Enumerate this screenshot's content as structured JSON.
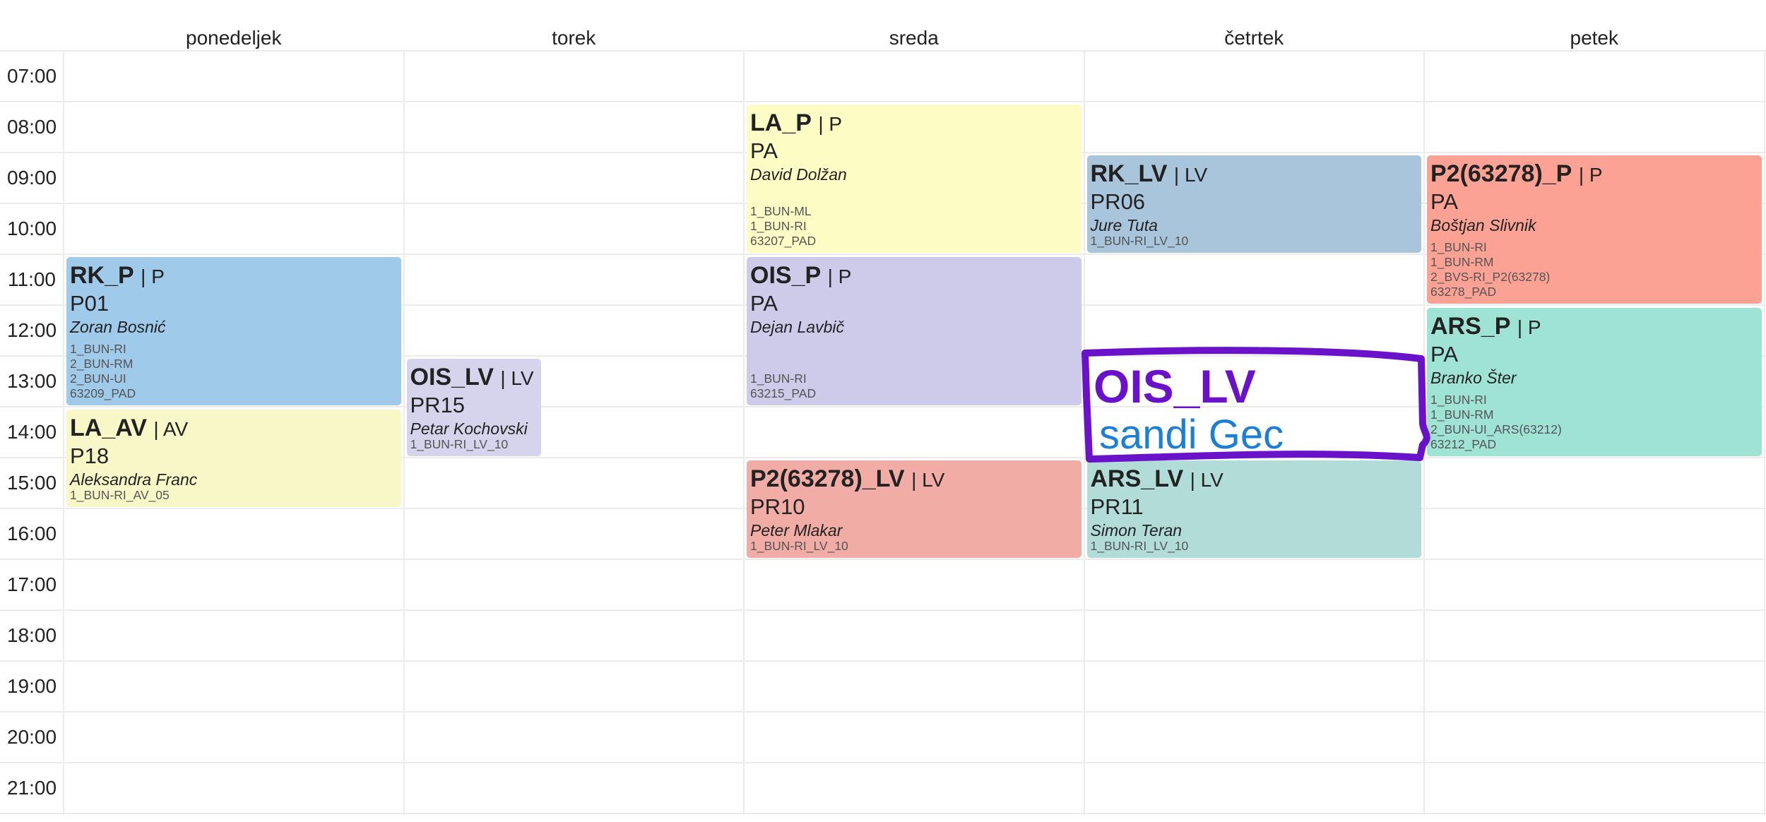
{
  "days": [
    "ponedeljek",
    "torek",
    "sreda",
    "četrtek",
    "petek"
  ],
  "times": [
    "07:00",
    "08:00",
    "09:00",
    "10:00",
    "11:00",
    "12:00",
    "13:00",
    "14:00",
    "15:00",
    "16:00",
    "17:00",
    "18:00",
    "19:00",
    "20:00",
    "21:00"
  ],
  "blocks": [
    {
      "id": "rk-p",
      "day": 0,
      "start": 11,
      "hours": 3,
      "code": "RK_P",
      "type": "| P",
      "room": "P01",
      "teacher": "Zoran Bosnić",
      "groups": [
        "1_BUN-RI",
        "2_BUN-RM",
        "2_BUN-UI",
        "63209_PAD"
      ],
      "color": "c-blue"
    },
    {
      "id": "la-av",
      "day": 0,
      "start": 14,
      "hours": 2,
      "code": "LA_AV",
      "type": "| AV",
      "room": "P18",
      "teacher": "Aleksandra Franc",
      "groups": [
        "1_BUN-RI_AV_05"
      ],
      "color": "c-ltyellow"
    },
    {
      "id": "ois-lv",
      "day": 1,
      "start": 13,
      "hours": 2,
      "code": "OIS_LV",
      "type": "| LV",
      "room": "PR15",
      "teacher": "Petar Kochovski",
      "groups": [
        "1_BUN-RI_LV_10"
      ],
      "color": "c-lavender2",
      "width": "narrow"
    },
    {
      "id": "la-p",
      "day": 2,
      "start": 8,
      "hours": 3,
      "code": "LA_P",
      "type": "| P",
      "room": "PA",
      "teacher": "David Dolžan",
      "groups": [
        "1_BUN-ML",
        "1_BUN-RI",
        "63207_PAD"
      ],
      "color": "c-yellow"
    },
    {
      "id": "ois-p",
      "day": 2,
      "start": 11,
      "hours": 3,
      "code": "OIS_P",
      "type": "| P",
      "room": "PA",
      "teacher": "Dejan Lavbič",
      "groups": [
        "1_BUN-RI",
        "63215_PAD"
      ],
      "color": "c-lavender"
    },
    {
      "id": "p2-lv",
      "day": 2,
      "start": 15,
      "hours": 2,
      "code": "P2(63278)_LV",
      "type": "| LV",
      "room": "PR10",
      "teacher": "Peter Mlakar",
      "groups": [
        "1_BUN-RI_LV_10"
      ],
      "color": "c-red"
    },
    {
      "id": "rk-lv",
      "day": 3,
      "start": 9,
      "hours": 2,
      "code": "RK_LV",
      "type": "| LV",
      "room": "PR06",
      "teacher": "Jure Tuta",
      "groups": [
        "1_BUN-RI_LV_10"
      ],
      "color": "c-steel"
    },
    {
      "id": "ars-lv",
      "day": 3,
      "start": 15,
      "hours": 2,
      "code": "ARS_LV",
      "type": "| LV",
      "room": "PR11",
      "teacher": "Simon Teran",
      "groups": [
        "1_BUN-RI_LV_10"
      ],
      "color": "c-mint"
    },
    {
      "id": "p2-p",
      "day": 4,
      "start": 9,
      "hours": 3,
      "code": "P2(63278)_P",
      "type": "| P",
      "room": "PA",
      "teacher": "Boštjan Slivnik",
      "groups": [
        "1_BUN-RI",
        "1_BUN-RM",
        "2_BVS-RI_P2(63278)",
        "63278_PAD"
      ],
      "color": "c-salmon"
    },
    {
      "id": "ars-p",
      "day": 4,
      "start": 12,
      "hours": 3,
      "code": "ARS_P",
      "type": "| P",
      "room": "PA",
      "teacher": "Branko Šter",
      "groups": [
        "1_BUN-RI",
        "1_BUN-RM",
        "2_BUN-UI_ARS(63212)",
        "63212_PAD"
      ],
      "color": "c-teal"
    }
  ],
  "annotation": {
    "line1": "OIS_LV",
    "line2": "sandi Gec",
    "box_color": "#6a12c9",
    "text1_color": "#6a12c9",
    "text2_color": "#1b7fd6"
  }
}
